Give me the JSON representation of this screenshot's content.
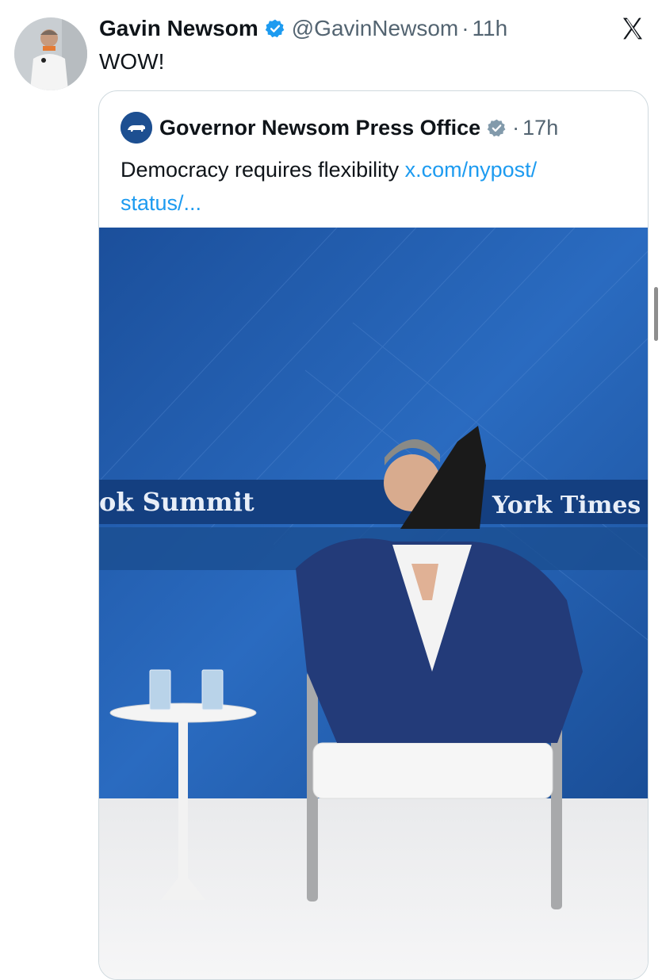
{
  "tweet": {
    "author_name": "Gavin Newsom",
    "handle": "@GavinNewsom",
    "separator": "·",
    "time": "11h",
    "text": "WOW!"
  },
  "quoted": {
    "author_name": "Governor Newsom Press Office",
    "separator": "·",
    "time": "17h",
    "text": "Democracy requires flexibility ",
    "link_line1": "x.com/nypost/",
    "link_line2": "status/..."
  },
  "photo": {
    "banner_left": "ok Summit",
    "banner_right": "York Times"
  },
  "icons": {
    "verified": "verified-badge-icon",
    "verified_gray": "verified-gray-badge-icon",
    "platform": "x-logo-icon"
  },
  "colors": {
    "verified_blue": "#1d9bf0",
    "verified_gray": "#829aab",
    "link": "#1d9bf0",
    "secondary_text": "#536471",
    "stage_blue": "#1e5cab"
  }
}
